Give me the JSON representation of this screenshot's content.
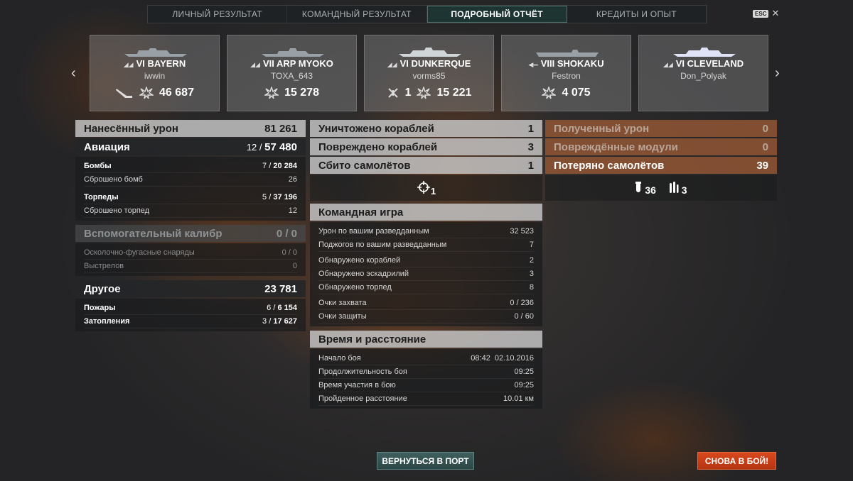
{
  "tabs": [
    {
      "label": "ЛИЧНЫЙ РЕЗУЛЬТАТ"
    },
    {
      "label": "КОМАНДНЫЙ РЕЗУЛЬТАТ"
    },
    {
      "label": "ПОДРОБНЫЙ ОТЧЁТ",
      "active": true
    },
    {
      "label": "КРЕДИТЫ И ОПЫТ"
    }
  ],
  "esc_label": "ESC",
  "close_glyph": "✕",
  "arrows": {
    "left": "‹",
    "right": "›"
  },
  "ships": [
    {
      "name": "VI BAYERN",
      "player": "iwwin",
      "stat1": "",
      "stat2": "46 687",
      "kill_icon": "torpedo-hit-icon"
    },
    {
      "name": "VII ARP MYOKO",
      "player": "TOXA_643",
      "stat1": "",
      "stat2": "15 278"
    },
    {
      "name": "VI DUNKERQUE",
      "player": "vorms85",
      "stat1": "1",
      "stat2": "15 221",
      "kill_icon": "plane-shot-icon"
    },
    {
      "name": "VIII SHOKAKU",
      "player": "Festron",
      "stat1": "",
      "stat2": "4 075"
    },
    {
      "name": "VI CLEVELAND",
      "player": "Don_Polyak",
      "stat1": "",
      "stat2": ""
    }
  ],
  "left": {
    "damage": {
      "label": "Нанесённый урон",
      "value": "81 261"
    },
    "aviation": {
      "label": "Авиация",
      "hits": "12 / ",
      "value": "57 480"
    },
    "bombs": {
      "label": "Бомбы",
      "hits": "7 / ",
      "value": "20 284"
    },
    "bombs_dropped": {
      "label": "Сброшено бомб",
      "value": "26"
    },
    "torps": {
      "label": "Торпеды",
      "hits": "5 / ",
      "value": "37 196"
    },
    "torps_dropped": {
      "label": "Сброшено торпед",
      "value": "12"
    },
    "secondary": {
      "label": "Вспомогательный калибр",
      "value": "0 / 0"
    },
    "he": {
      "label": "Осколочно-фугасные снаряды",
      "value": "0 / 0"
    },
    "shots": {
      "label": "Выстрелов",
      "value": "0"
    },
    "other": {
      "label": "Другое",
      "value": "23 781"
    },
    "fires": {
      "label": "Пожары",
      "hits": "6 / ",
      "value": "6 154"
    },
    "floods": {
      "label": "Затопления",
      "hits": "3 / ",
      "value": "17 627"
    }
  },
  "middle": {
    "destroyed": {
      "label": "Уничтожено кораблей",
      "value": "1"
    },
    "damaged": {
      "label": "Повреждено кораблей",
      "value": "3"
    },
    "planes": {
      "label": "Сбито самолётов",
      "value": "1"
    },
    "crosshair_count": "1",
    "team": {
      "title": "Командная игра",
      "rows": [
        {
          "label": "Урон по вашим разведданным",
          "value": "32 523"
        },
        {
          "label": "Поджогов по вашим разведданным",
          "value": "7"
        },
        {
          "label": "Обнаружено кораблей",
          "value": "2"
        },
        {
          "label": "Обнаружено эскадрилий",
          "value": "3"
        },
        {
          "label": "Обнаружено торпед",
          "value": "8"
        },
        {
          "label": "Очки захвата",
          "value": "0 / 236"
        },
        {
          "label": "Очки защиты",
          "value": "0 / 60"
        }
      ]
    },
    "time": {
      "title": "Время и расстояние",
      "rows": [
        {
          "label": "Начало боя",
          "value": "08:42  02.10.2016"
        },
        {
          "label": "Продолжительность боя",
          "value": "09:25"
        },
        {
          "label": "Время участия в бою",
          "value": "09:25"
        },
        {
          "label": "Пройденное расстояние",
          "value": "10.01 км"
        }
      ]
    }
  },
  "right": {
    "received": {
      "label": "Полученный урон",
      "value": "0"
    },
    "modules": {
      "label": "Повреждённые модули",
      "value": "0"
    },
    "lost": {
      "label": "Потеряно самолётов",
      "value": "39"
    },
    "bombers_lost": "36",
    "torp_bombers_lost": "3"
  },
  "buttons": {
    "port": "ВЕРНУТЬСЯ В ПОРТ",
    "battle": "СНОВА В БОЙ!"
  },
  "colors": {
    "accent_tab": "#1e3433",
    "port_button": "#2b4645",
    "battle_button": "#c63d16",
    "received_panel": "#8e5434"
  }
}
